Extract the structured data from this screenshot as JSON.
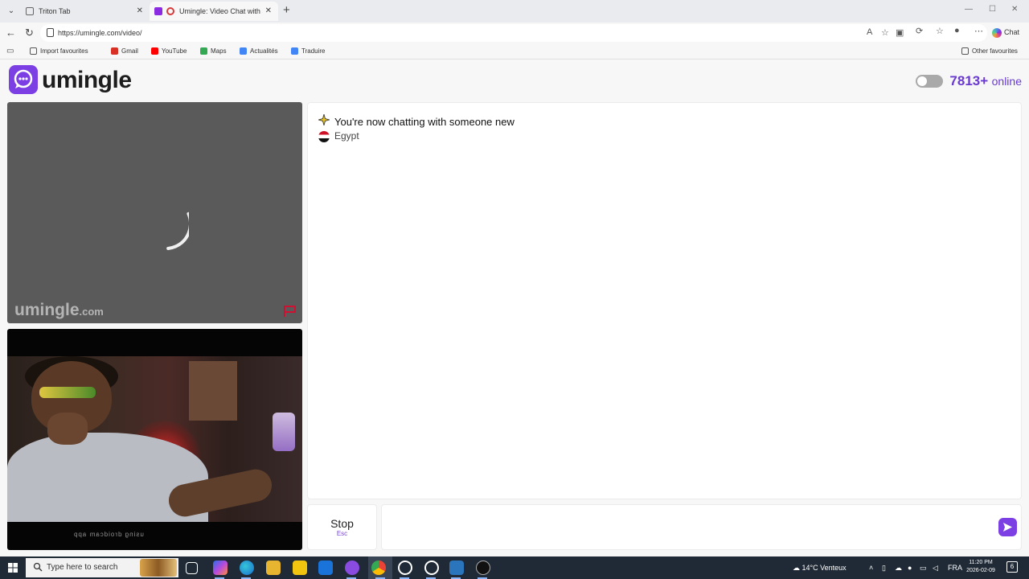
{
  "browser": {
    "tabs": [
      {
        "title": "Triton Tab"
      },
      {
        "title": "Umingle: Video Chat with Strangers"
      }
    ],
    "url": "https://umingle.com/video/",
    "chat_label": "Chat",
    "bookmarks": [
      {
        "label": "Import favourites",
        "color": "#555555"
      },
      {
        "label": "Gmail",
        "color": "#d93025"
      },
      {
        "label": "YouTube",
        "color": "#ff0000"
      },
      {
        "label": "Maps",
        "color": "#34a853"
      },
      {
        "label": "Actualités",
        "color": "#4285f4"
      },
      {
        "label": "Traduire",
        "color": "#4285f4"
      }
    ],
    "other_favourites": "Other favourites"
  },
  "site": {
    "logo_text": "umingle",
    "online_count": "7813+",
    "online_label": "online",
    "watermark": "umingle",
    "watermark_domain": ".com",
    "brand_color": "#7b3fe4"
  },
  "video": {
    "self_caption": "using droidcam app"
  },
  "chat": {
    "status_message": "You're now chatting with someone new",
    "country": "Egypt"
  },
  "controls": {
    "stop_label": "Stop",
    "stop_key": "Esc",
    "message_placeholder": ""
  },
  "taskbar": {
    "search_placeholder": "Type here to search",
    "weather": "14°C Venteux",
    "language": "FRA",
    "time": "11:20 PM",
    "date": "2026-02-09",
    "notifications": "6"
  }
}
